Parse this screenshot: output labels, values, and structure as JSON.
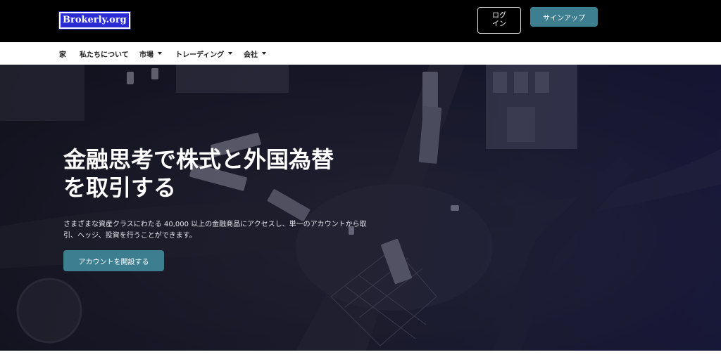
{
  "header": {
    "logo_text": "Brokerly.org",
    "login_label": "ログイン",
    "signup_label": "サインアップ"
  },
  "nav": {
    "items": [
      {
        "label": "家",
        "has_dropdown": false
      },
      {
        "label": "私たちについて",
        "has_dropdown": false
      },
      {
        "label": "市場",
        "has_dropdown": true
      },
      {
        "label": "トレーディング",
        "has_dropdown": true
      },
      {
        "label": "会社",
        "has_dropdown": true
      }
    ]
  },
  "hero": {
    "title_line1": "金融思考で株式と外国為替",
    "title_line2": "を取引する",
    "description": "さまざまな資産クラスにわたる 40,000 以上の金融商品にアクセスし、単一のアカウントから取引、ヘッジ、投資を行うことができます。",
    "cta_label": "アカウントを開設する"
  },
  "colors": {
    "accent": "#3d7f91",
    "topbar": "#000000",
    "logo_bg": "#2b2bd6"
  }
}
